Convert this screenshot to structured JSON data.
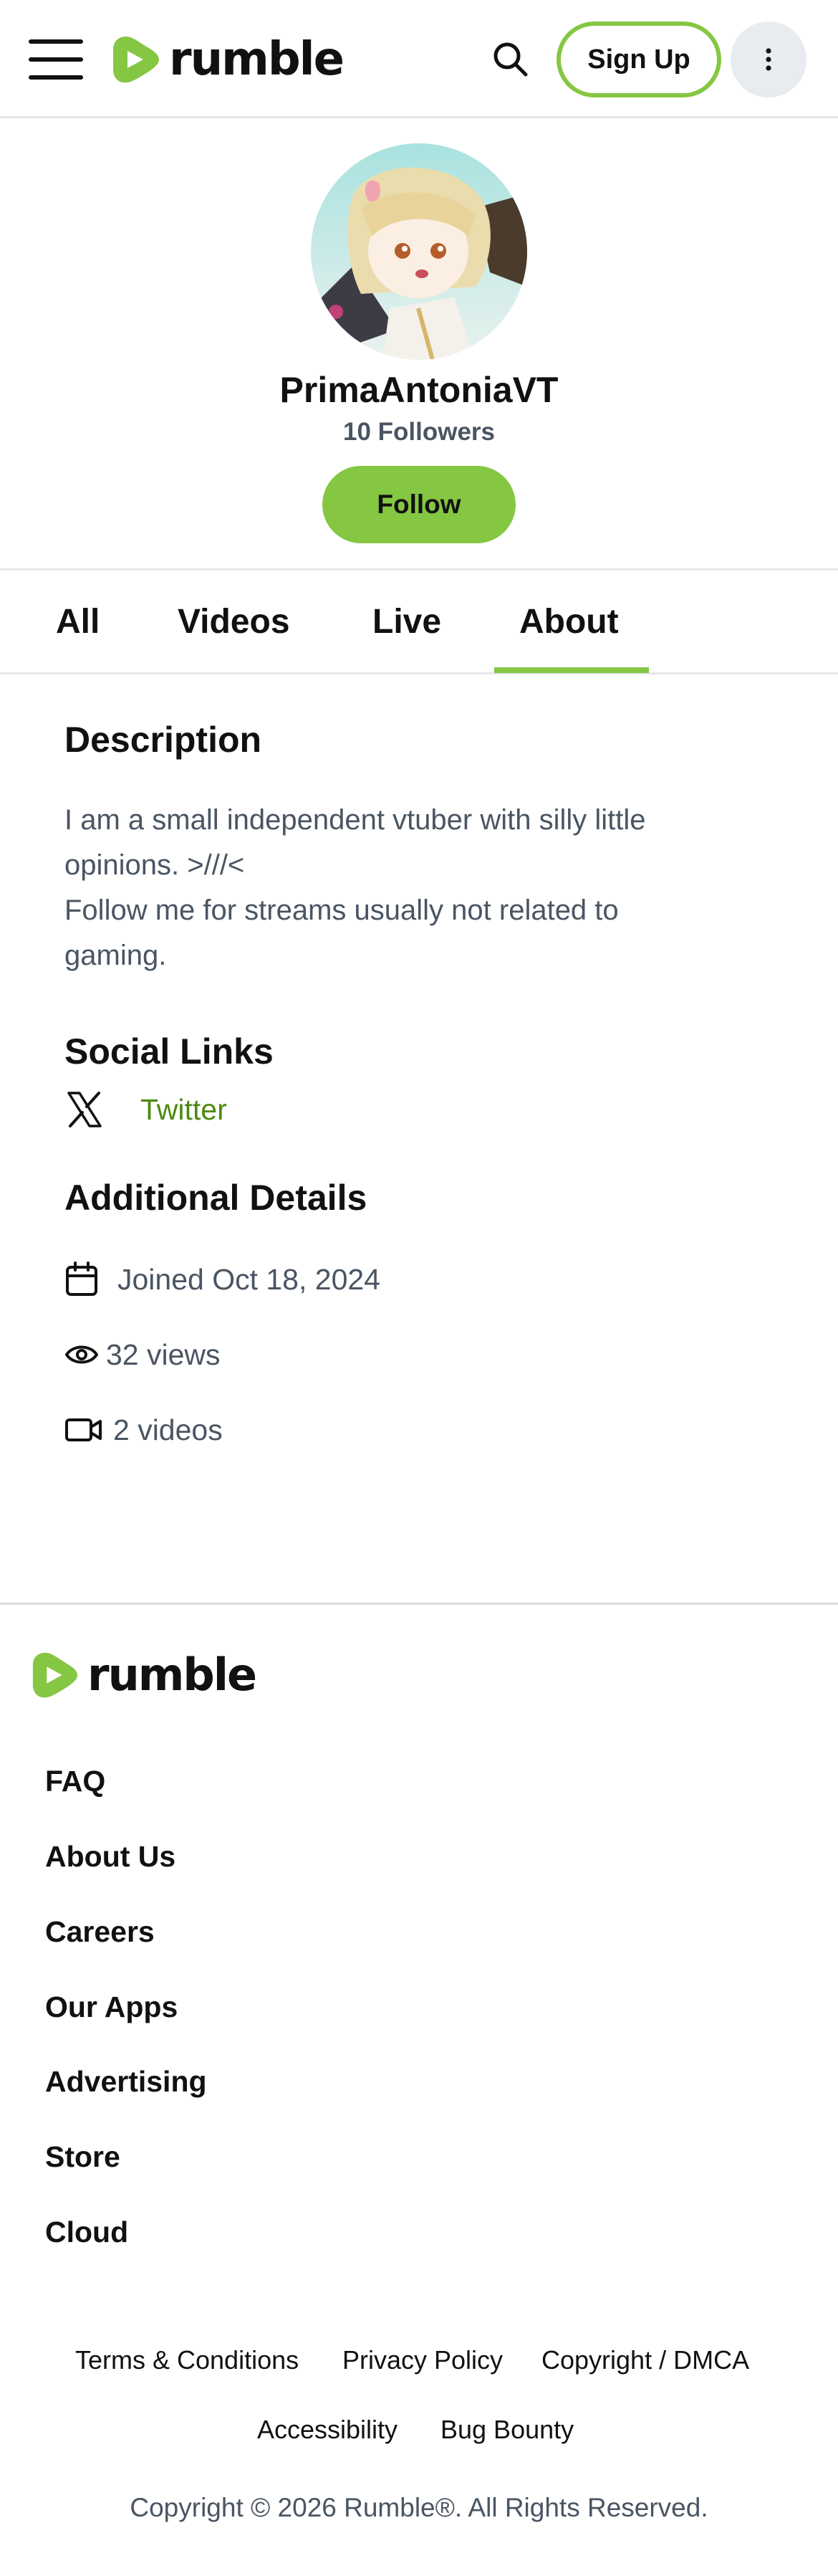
{
  "header": {
    "menu_icon": "hamburger-menu-icon",
    "logo_text": "rumble",
    "search_icon": "search-icon",
    "signup_label": "Sign Up",
    "more_icon": "vertical-ellipsis-icon"
  },
  "profile": {
    "avatar": "avatar-image",
    "name": "PrimaAntoniaVT",
    "followers": "10 Followers",
    "follow_label": "Follow"
  },
  "tabs": {
    "items": [
      {
        "label": "All"
      },
      {
        "label": "Videos"
      },
      {
        "label": "Live"
      },
      {
        "label": "About"
      }
    ],
    "active": "About"
  },
  "about": {
    "description_heading": "Description",
    "description_lines": [
      "I am a small independent vtuber with silly little",
      "opinions. >///<",
      "Follow me for streams usually not related to",
      "gaming."
    ],
    "social_heading": "Social Links",
    "social_links": [
      {
        "label": "Twitter",
        "icon": "x-logo-icon"
      }
    ],
    "details_heading": "Additional Details",
    "joined": "Joined Oct 18, 2024",
    "views": "32 views",
    "videos": "2 videos"
  },
  "footer": {
    "logo_text": "rumble",
    "nav": [
      "FAQ",
      "About Us",
      "Careers",
      "Our Apps",
      "Advertising",
      "Store",
      "Cloud"
    ],
    "legal_row1": [
      "Terms & Conditions",
      "Privacy Policy",
      "Copyright / DMCA"
    ],
    "legal_row2": [
      "Accessibility",
      "Bug Bounty"
    ],
    "copyright": "Copyright © 2026 Rumble®. All Rights Reserved."
  },
  "colors": {
    "brand_green": "#85c742",
    "link_green": "#4d8a10",
    "muted_text": "#4a5563",
    "divider": "#e3e6ea"
  }
}
